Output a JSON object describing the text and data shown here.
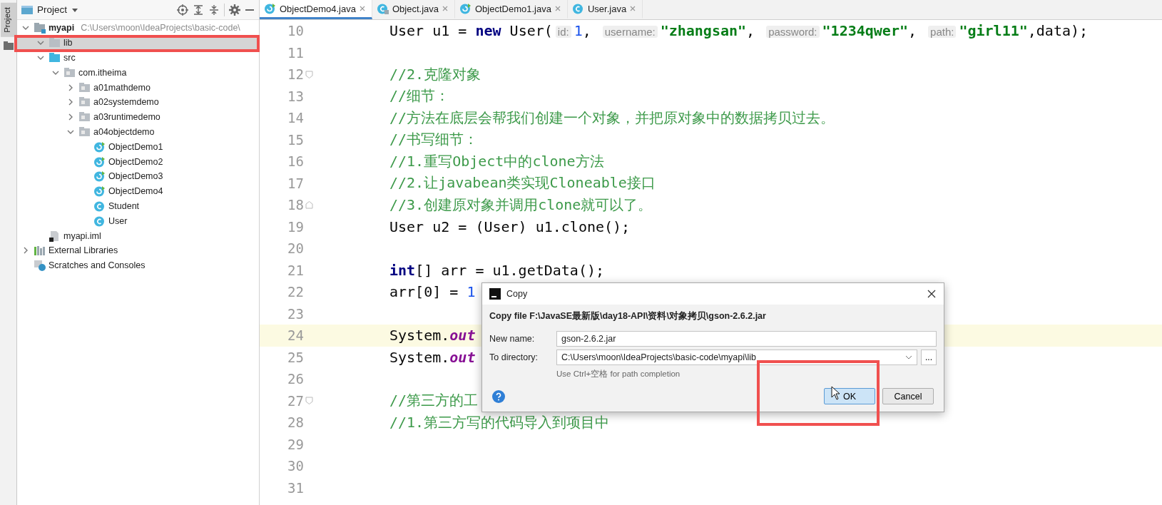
{
  "tool_stripe": {
    "label": "Project"
  },
  "project": {
    "title": "Project",
    "tree": [
      {
        "label": "myapi",
        "kind": "module",
        "path": "C:\\Users\\moon\\IdeaProjects\\basic-code\\",
        "expanded": true,
        "selected": false,
        "children": [
          {
            "label": "lib",
            "kind": "folder",
            "expanded": true,
            "selected": true
          },
          {
            "label": "src",
            "kind": "source",
            "expanded": true,
            "selected": false,
            "children": [
              {
                "label": "com.itheima",
                "kind": "package",
                "expanded": true,
                "selected": false,
                "children": [
                  {
                    "label": "a01mathdemo",
                    "kind": "package",
                    "expanded": false,
                    "selected": false
                  },
                  {
                    "label": "a02systemdemo",
                    "kind": "package",
                    "expanded": false,
                    "selected": false
                  },
                  {
                    "label": "a03runtimedemo",
                    "kind": "package",
                    "expanded": false,
                    "selected": false
                  },
                  {
                    "label": "a04objectdemo",
                    "kind": "package",
                    "expanded": true,
                    "selected": false,
                    "children": [
                      {
                        "label": "ObjectDemo1",
                        "kind": "main-class",
                        "selected": false
                      },
                      {
                        "label": "ObjectDemo2",
                        "kind": "main-class",
                        "selected": false
                      },
                      {
                        "label": "ObjectDemo3",
                        "kind": "main-class",
                        "selected": false
                      },
                      {
                        "label": "ObjectDemo4",
                        "kind": "main-class",
                        "selected": false
                      },
                      {
                        "label": "Student",
                        "kind": "class",
                        "selected": false
                      },
                      {
                        "label": "User",
                        "kind": "class",
                        "selected": false
                      }
                    ]
                  }
                ]
              }
            ]
          },
          {
            "label": "myapi.iml",
            "kind": "file",
            "selected": false
          }
        ]
      },
      {
        "label": "External Libraries",
        "kind": "libraries",
        "expanded": false,
        "selected": false
      },
      {
        "label": "Scratches and Consoles",
        "kind": "scratches",
        "selected": false
      }
    ]
  },
  "tabs": [
    {
      "label": "ObjectDemo4.java",
      "kind": "main-class",
      "selected": true
    },
    {
      "label": "Object.java",
      "kind": "library-class",
      "selected": false
    },
    {
      "label": "ObjectDemo1.java",
      "kind": "main-class",
      "selected": false
    },
    {
      "label": "User.java",
      "kind": "class",
      "selected": false
    }
  ],
  "editor": {
    "lines": [
      {
        "number": "10",
        "current": false,
        "tokens": [
          {
            "kind": "plain",
            "text": "User u1 = "
          },
          {
            "kind": "keyword",
            "text": "new"
          },
          {
            "kind": "plain",
            "text": " User("
          },
          {
            "kind": "hint",
            "text": "id:"
          },
          {
            "kind": "number",
            "text": "1"
          },
          {
            "kind": "plain",
            "text": ", "
          },
          {
            "kind": "hint",
            "text": "username:"
          },
          {
            "kind": "string",
            "text": "\"zhangsan\""
          },
          {
            "kind": "plain",
            "text": ", "
          },
          {
            "kind": "hint",
            "text": "password:"
          },
          {
            "kind": "string",
            "text": "\"1234qwer\""
          },
          {
            "kind": "plain",
            "text": ", "
          },
          {
            "kind": "hint",
            "text": "path:"
          },
          {
            "kind": "string",
            "text": "\"girl11\""
          },
          {
            "kind": "plain",
            "text": ",data);"
          }
        ]
      },
      {
        "number": "11",
        "current": false
      },
      {
        "number": "12",
        "current": false,
        "kind": "fold-start",
        "tokens": [
          {
            "kind": "comment",
            "text": "//2.克隆对象"
          }
        ]
      },
      {
        "number": "13",
        "current": false,
        "tokens": [
          {
            "kind": "comment",
            "text": "//细节："
          }
        ]
      },
      {
        "number": "14",
        "current": false,
        "tokens": [
          {
            "kind": "comment",
            "text": "//方法在底层会帮我们创建一个对象，并把原对象中的数据拷贝过去。"
          }
        ]
      },
      {
        "number": "15",
        "current": false,
        "tokens": [
          {
            "kind": "comment",
            "text": "//书写细节："
          }
        ]
      },
      {
        "number": "16",
        "current": false,
        "tokens": [
          {
            "kind": "comment",
            "text": "//1.重写Object中的clone方法"
          }
        ]
      },
      {
        "number": "17",
        "current": false,
        "tokens": [
          {
            "kind": "comment",
            "text": "//2.让javabean类实现Cloneable接口"
          }
        ]
      },
      {
        "number": "18",
        "current": false,
        "kind": "fold-end",
        "tokens": [
          {
            "kind": "comment",
            "text": "//3.创建原对象并调用clone就可以了。"
          }
        ]
      },
      {
        "number": "19",
        "current": false,
        "tokens": [
          {
            "kind": "plain",
            "text": "User u2 = (User) u1.clone();"
          }
        ]
      },
      {
        "number": "20",
        "current": false
      },
      {
        "number": "21",
        "current": false,
        "tokens": [
          {
            "kind": "keyword",
            "text": "int"
          },
          {
            "kind": "plain",
            "text": "[] arr = u1.getData();"
          }
        ]
      },
      {
        "number": "22",
        "current": false,
        "tokens": [
          {
            "kind": "plain",
            "text": "arr[0] = "
          },
          {
            "kind": "number",
            "text": "1"
          }
        ]
      },
      {
        "number": "23",
        "current": false
      },
      {
        "number": "24",
        "current": true,
        "tokens": [
          {
            "kind": "plain",
            "text": "System."
          },
          {
            "kind": "field",
            "text": "out"
          }
        ]
      },
      {
        "number": "25",
        "current": false,
        "tokens": [
          {
            "kind": "plain",
            "text": "System."
          },
          {
            "kind": "field",
            "text": "out"
          }
        ]
      },
      {
        "number": "26",
        "current": false
      },
      {
        "number": "27",
        "current": false,
        "kind": "fold-start",
        "tokens": [
          {
            "kind": "comment",
            "text": "//第三方的工"
          }
        ]
      },
      {
        "number": "28",
        "current": false,
        "tokens": [
          {
            "kind": "comment",
            "text": "//1.第三方写的代码导入到项目中"
          }
        ]
      },
      {
        "number": "29",
        "current": false
      },
      {
        "number": "30",
        "current": false
      },
      {
        "number": "31",
        "current": false
      }
    ]
  },
  "dialog": {
    "title": "Copy",
    "message": "Copy file F:\\JavaSE最新版\\day18-API\\资料\\对象拷贝\\gson-2.6.2.jar",
    "fields": [
      {
        "label": "New name:",
        "value": "gson-2.6.2.jar",
        "kind": "text"
      },
      {
        "label": "To directory:",
        "value": "C:\\Users\\moon\\IdeaProjects\\basic-code\\myapi\\lib",
        "kind": "combo"
      }
    ],
    "hint": "Use Ctrl+空格 for path completion",
    "browse": "...",
    "buttons": [
      {
        "label": "OK",
        "default": true
      },
      {
        "label": "Cancel",
        "default": false
      }
    ]
  }
}
